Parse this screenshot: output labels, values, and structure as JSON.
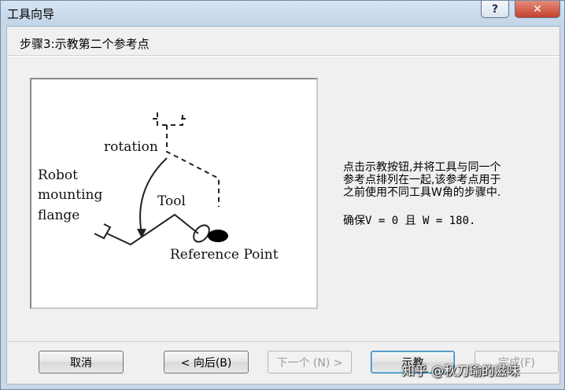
{
  "window": {
    "title": "工具向导",
    "help_label": "?",
    "close_label": "✕"
  },
  "step": {
    "title": "步骤3:示教第二个参考点"
  },
  "figure": {
    "rotation_label": "rotation",
    "robot_label_1": "Robot",
    "robot_label_2": "mounting",
    "robot_label_3": "flange",
    "tool_label": "Tool",
    "reference_label": "Reference Point"
  },
  "instructions": {
    "line1": "点击示教按钮,并将工具与同一个",
    "line2": "参考点排列在一起,该参考点用于",
    "line3": "之前使用不同工具W角的步骤中.",
    "ensure": "确保V = 0 且 W = 180."
  },
  "buttons": {
    "cancel": "取消",
    "back": "< 向后(B)",
    "next": "下一个 (N) >",
    "teach": "示教",
    "finish": "完成(F)"
  },
  "watermark": "知乎 @秋刀瑜的滋味"
}
